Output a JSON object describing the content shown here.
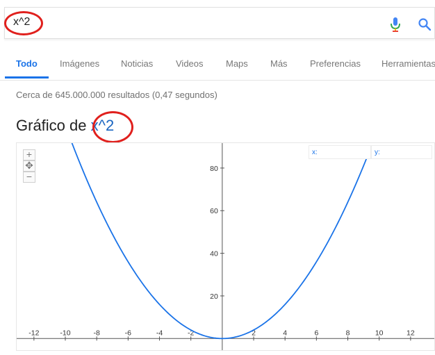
{
  "search": {
    "query": "x^2"
  },
  "tabs": [
    {
      "label": "Todo",
      "active": true
    },
    {
      "label": "Imágenes"
    },
    {
      "label": "Noticias"
    },
    {
      "label": "Videos"
    },
    {
      "label": "Maps"
    },
    {
      "label": "Más"
    },
    {
      "label": "Preferencias"
    },
    {
      "label": "Herramientas"
    }
  ],
  "results_stats": "Cerca de 645.000.000 resultados (0,47 segundos)",
  "graph": {
    "title_prefix": "Gráfico de",
    "function": "x^2",
    "controls": {
      "zoom_in": "+",
      "zoom_out": "−",
      "pan": "✥"
    },
    "readout": {
      "x_label": "x:",
      "y_label": "y:"
    }
  },
  "colors": {
    "accent": "#1a73e8",
    "curve": "#1a73e8",
    "annotation": "#e0201d"
  },
  "icons": {
    "mic": "microphone-icon",
    "search": "search-icon"
  },
  "chart_data": {
    "type": "line",
    "function": "x^2",
    "series": [
      {
        "x": [
          -9.6,
          -9,
          -8,
          -7,
          -6,
          -5,
          -4,
          -3,
          -2,
          -1,
          0,
          1,
          2,
          3,
          4,
          5,
          6,
          7,
          8,
          9,
          9.2
        ],
        "y": [
          92.16,
          81,
          64,
          49,
          36,
          25,
          16,
          9,
          4,
          1,
          0,
          1,
          4,
          9,
          16,
          25,
          36,
          49,
          64,
          81,
          84.64
        ]
      }
    ],
    "xlim": [
      -13.1,
      13.6
    ],
    "ylim": [
      -6.1,
      91.7
    ],
    "x_ticks": [
      -12,
      -10,
      -8,
      -6,
      -4,
      -2,
      2,
      4,
      6,
      8,
      10,
      12
    ],
    "y_ticks": [
      20,
      40,
      60,
      80
    ],
    "grid": false
  }
}
